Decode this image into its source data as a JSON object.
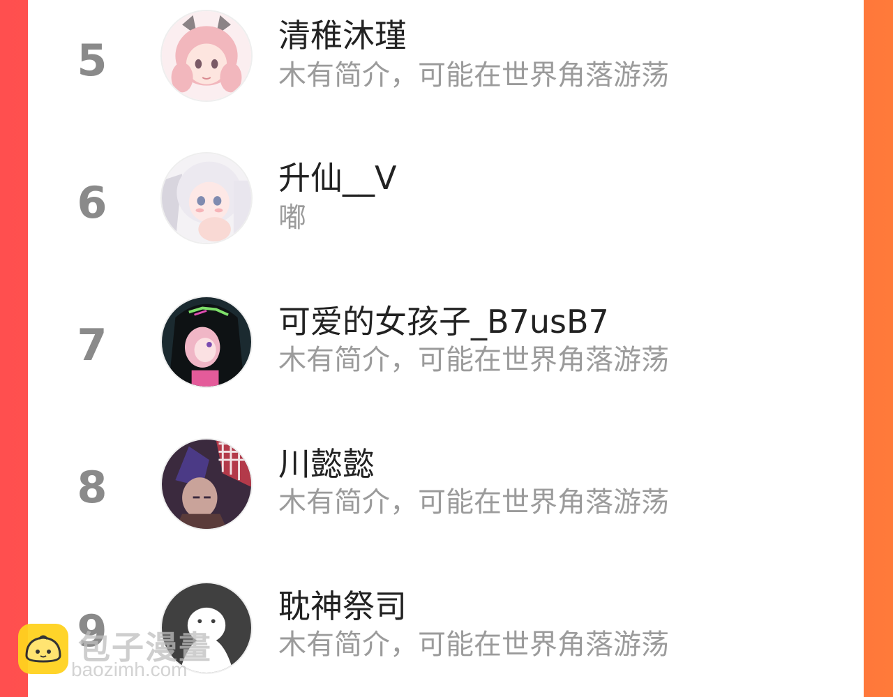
{
  "ranking": {
    "items": [
      {
        "rank": "5",
        "name": "清稚沐瑾",
        "bio": "木有简介，可能在世界角落游荡",
        "avatar": "anime-girl-pink-hair-avatar"
      },
      {
        "rank": "6",
        "name": "升仙__V",
        "bio": "嘟",
        "avatar": "anime-girl-white-hair-avatar"
      },
      {
        "rank": "7",
        "name": "可爱的女孩子_B7usB7",
        "bio": "木有简介，可能在世界角落游荡",
        "avatar": "anime-girl-hoodie-avatar"
      },
      {
        "rank": "8",
        "name": "川懿懿",
        "bio": "木有简介，可能在世界角落游荡",
        "avatar": "game-character-helmet-avatar"
      },
      {
        "rank": "9",
        "name": "耽神祭司",
        "bio": "木有简介，可能在世界角落游荡",
        "avatar": "default-ghost-avatar"
      }
    ]
  },
  "watermark": {
    "title": "包子漫畫",
    "url": "baozimh.com",
    "icon": "bun-face-logo-icon"
  },
  "colors": {
    "frame_left": "#ff4f4f",
    "frame_right": "#ff7a3a",
    "rank": "#8a8a8a",
    "name": "#222222",
    "bio": "#9b9b9b",
    "logo": "#ffd21f"
  }
}
